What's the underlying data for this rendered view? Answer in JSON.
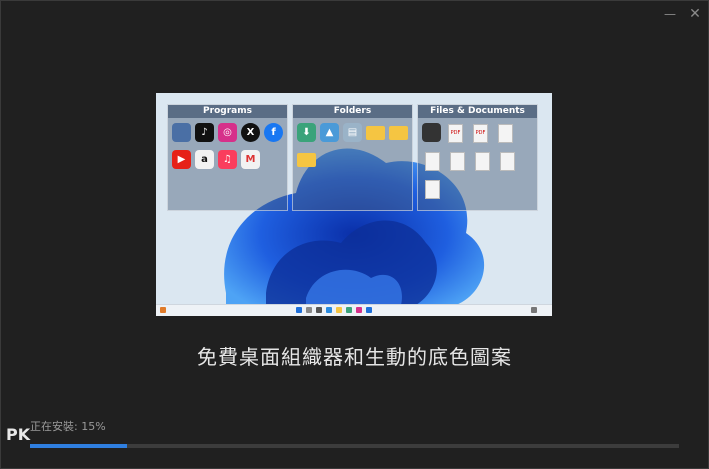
{
  "window": {
    "minimize_glyph": "—",
    "close_glyph": "✕"
  },
  "preview": {
    "fences": [
      {
        "title": "Programs"
      },
      {
        "title": "Folders"
      },
      {
        "title": "Files & Documents"
      }
    ],
    "doc_badge": "PDF"
  },
  "caption": "免費桌面組織器和生動的底色圖案",
  "install": {
    "status_text": "正在安裝: 15%",
    "progress_fraction": 0.15
  },
  "watermark": {
    "logo": "PK"
  },
  "colors": {
    "accent": "#2f7fe0",
    "background": "#202020"
  }
}
